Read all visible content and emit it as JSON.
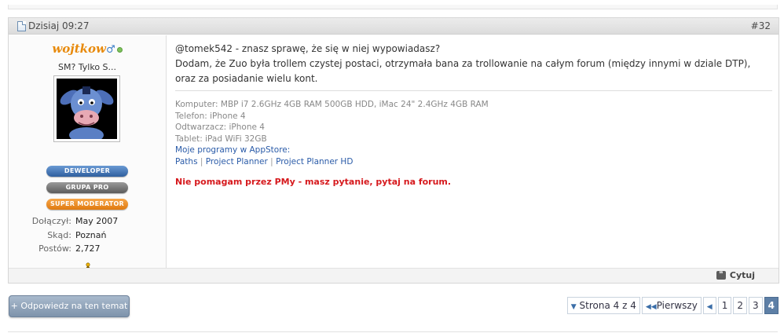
{
  "post": {
    "date": "Dzisiaj 09:27",
    "number": "#32",
    "user": {
      "name": "wojtkow",
      "gender_symbol": "♂",
      "title": "SM? Tylko S...",
      "ranks": [
        "DEWELOPER",
        "GRUPA PRO",
        "SUPER MODERATOR"
      ],
      "stats": [
        {
          "label": "Dołączył:",
          "value": "May 2007"
        },
        {
          "label": "Skąd:",
          "value": "Poznań"
        },
        {
          "label": "Postów:",
          "value": "2,727"
        }
      ],
      "im_icon": "aim-icon"
    },
    "message": {
      "line1": "@tomek542 - znasz sprawę, że się w niej wypowiadasz?",
      "line2": "Dodam, że Zuo była trollem czystej postaci, otrzymała bana za trollowanie na całym forum (między innymi w dziale DTP), oraz za posiadanie wielu kont."
    },
    "signature": {
      "computer": "Komputer: MBP i7 2.6GHz 4GB RAM 500GB HDD, iMac 24\" 2.4GHz 4GB RAM",
      "phone": "Telefon: iPhone 4",
      "player": "Odtwarzacz: iPhone 4",
      "tablet": "Tablet: iPad WiFi 32GB",
      "apps_heading": "Moje programy w AppStore:",
      "apps": [
        "Paths",
        "Project Planner",
        "Project Planner HD"
      ],
      "separator": "|",
      "note": "Nie pomagam przez PMy - masz pytanie, pytaj na forum."
    },
    "quote_label": "Cytuj"
  },
  "reply_button": "+ Odpowiedz na ten temat",
  "pagination": {
    "page_label": "Strona 4 z 4",
    "first_label": "Pierwszy",
    "pages": [
      "1",
      "2",
      "3",
      "4"
    ],
    "current": "4"
  },
  "colors": {
    "username": "#e88a0c",
    "note": "#d6191d",
    "link": "#2a5ba8",
    "rank_dev": "#2f5f9e",
    "rank_pro": "#5c5c5c",
    "rank_mod": "#e07a10",
    "current_page": "#5d7fa6"
  }
}
